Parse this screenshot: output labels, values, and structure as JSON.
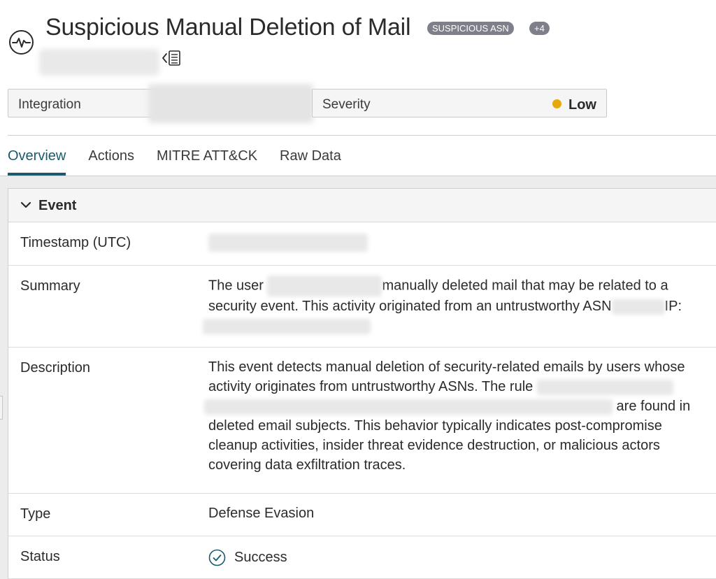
{
  "header": {
    "title": "Suspicious Manual Deletion of Mail",
    "tags": [
      "SUSPICIOUS ASN",
      "+4"
    ]
  },
  "fields": {
    "integration_label": "Integration",
    "severity_label": "Severity",
    "severity_value": "Low",
    "severity_color": "#e6a90c"
  },
  "tabs": [
    {
      "label": "Overview",
      "active": true
    },
    {
      "label": "Actions",
      "active": false
    },
    {
      "label": "MITRE ATT&CK",
      "active": false
    },
    {
      "label": "Raw Data",
      "active": false
    }
  ],
  "event": {
    "section_title": "Event",
    "rows": {
      "timestamp_label": "Timestamp (UTC)",
      "summary_label": "Summary",
      "summary_part1": "The user ",
      "summary_part2": "manually deleted mail that may be related to a security event. This activity originated from an untrustworthy ASN",
      "summary_part3": "IP:",
      "description_label": "Description",
      "description_part1": "This event detects manual deletion of security-related emails by users whose activity originates from untrustworthy ASNs. The rule",
      "description_part2": " are found in deleted email subjects. This behavior typically indicates post-compromise cleanup activities, insider threat evidence destruction, or malicious actors covering data exfiltration traces.",
      "type_label": "Type",
      "type_value": "Defense Evasion",
      "status_label": "Status",
      "status_value": "Success"
    }
  },
  "colors": {
    "accent": "#1a5a6b",
    "badge_bg": "#7e7f8a"
  }
}
